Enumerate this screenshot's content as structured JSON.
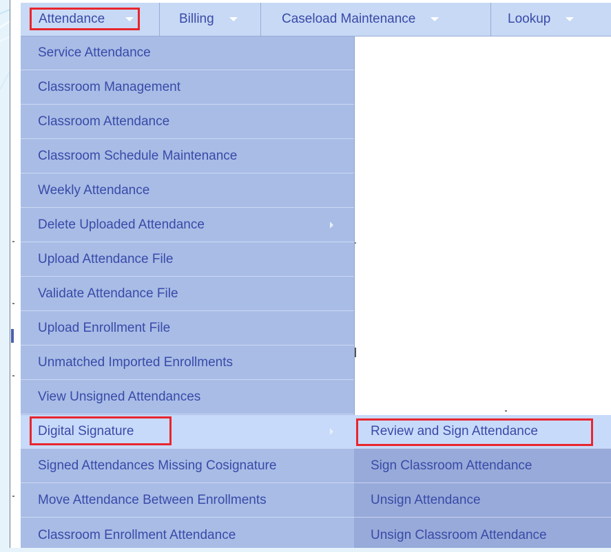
{
  "menubar": {
    "items": [
      {
        "label": "Attendance",
        "icon": "chevron-down-icon"
      },
      {
        "label": "Billing",
        "icon": "chevron-down-icon"
      },
      {
        "label": "Caseload Maintenance",
        "icon": "chevron-down-icon"
      },
      {
        "label": "Lookup",
        "icon": "chevron-down-icon"
      }
    ]
  },
  "attendance_menu": {
    "items": [
      {
        "label": "Service Attendance"
      },
      {
        "label": "Classroom Management"
      },
      {
        "label": "Classroom Attendance"
      },
      {
        "label": "Classroom Schedule Maintenance"
      },
      {
        "label": "Weekly Attendance"
      },
      {
        "label": "Delete Uploaded Attendance",
        "has_submenu": true
      },
      {
        "label": "Upload Attendance File"
      },
      {
        "label": "Validate Attendance File"
      },
      {
        "label": "Upload Enrollment File"
      },
      {
        "label": "Unmatched Imported Enrollments"
      },
      {
        "label": "View Unsigned Attendances"
      },
      {
        "label": "Digital Signature",
        "has_submenu": true,
        "highlighted": true
      },
      {
        "label": "Signed Attendances Missing Cosignature"
      },
      {
        "label": "Move Attendance Between Enrollments"
      },
      {
        "label": "Classroom Enrollment Attendance"
      }
    ]
  },
  "digital_signature_submenu": {
    "items": [
      {
        "label": "Review and Sign Attendance",
        "highlighted": true
      },
      {
        "label": "Sign Classroom Attendance"
      },
      {
        "label": "Unsign Attendance"
      },
      {
        "label": "Unsign Classroom Attendance"
      }
    ]
  },
  "colors": {
    "menubar_bg": "#c7d9f5",
    "menu_bg": "#a8bce6",
    "submenu_bg": "#97aad9",
    "hover_bg": "#c8dafa",
    "text": "#3a4aa8",
    "highlight_border": "#e8252c"
  }
}
